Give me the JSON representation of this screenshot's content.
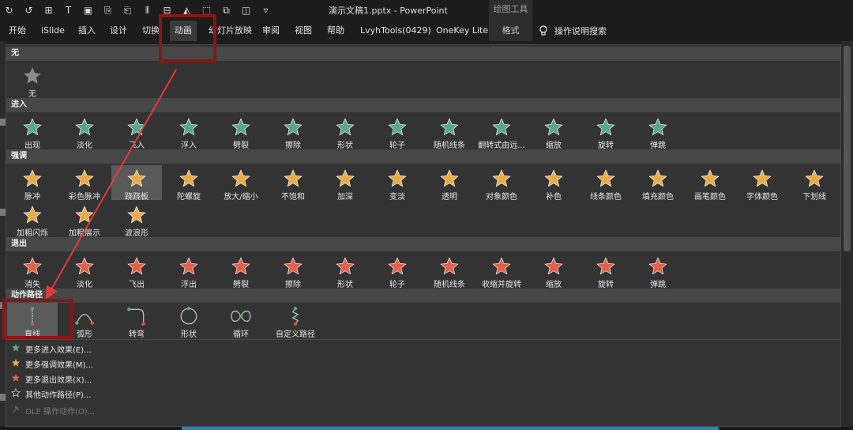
{
  "window": {
    "title": "演示文稿1.pptx  -  PowerPoint",
    "context_group": "绘图工具"
  },
  "ribbon": {
    "tabs": [
      {
        "label": "开始"
      },
      {
        "label": "iSlide"
      },
      {
        "label": "插入"
      },
      {
        "label": "设计"
      },
      {
        "label": "切换"
      },
      {
        "label": "动画",
        "active": true
      },
      {
        "label": "幻灯片放映"
      },
      {
        "label": "审阅"
      },
      {
        "label": "视图"
      },
      {
        "label": "帮助"
      },
      {
        "label": "LvyhTools(0429)"
      },
      {
        "label": "OneKey Lite"
      },
      {
        "label": "格式"
      }
    ],
    "search_label": "操作说明搜索"
  },
  "gallery": {
    "none_section": {
      "header": "无",
      "items": [
        {
          "label": "无",
          "icon": "star-gray-icon"
        }
      ]
    },
    "entrance": {
      "header": "进入",
      "color": "#5aa58e",
      "items": [
        {
          "label": "出现"
        },
        {
          "label": "淡化"
        },
        {
          "label": "飞入"
        },
        {
          "label": "浮入"
        },
        {
          "label": "劈裂"
        },
        {
          "label": "擦除"
        },
        {
          "label": "形状"
        },
        {
          "label": "轮子"
        },
        {
          "label": "随机线条"
        },
        {
          "label": "翻转式由远..."
        },
        {
          "label": "缩放"
        },
        {
          "label": "旋转"
        },
        {
          "label": "弹跳"
        }
      ]
    },
    "emphasis": {
      "header": "强调",
      "color": "#e9ab4a",
      "selected_label": "跷跷板",
      "items_row1": [
        {
          "label": "脉冲"
        },
        {
          "label": "彩色脉冲"
        },
        {
          "label": "跷跷板"
        },
        {
          "label": "陀螺旋"
        },
        {
          "label": "放大/缩小"
        },
        {
          "label": "不饱和"
        },
        {
          "label": "加深"
        },
        {
          "label": "变淡"
        },
        {
          "label": "透明"
        },
        {
          "label": "对象颜色"
        },
        {
          "label": "补色"
        },
        {
          "label": "线条颜色"
        },
        {
          "label": "填充颜色"
        },
        {
          "label": "画笔颜色"
        },
        {
          "label": "字体颜色"
        },
        {
          "label": "下划线"
        }
      ],
      "items_row2": [
        {
          "label": "加粗闪烁"
        },
        {
          "label": "加粗展示"
        },
        {
          "label": "波浪形"
        }
      ]
    },
    "exit": {
      "header": "退出",
      "color": "#e0614c",
      "items": [
        {
          "label": "消失"
        },
        {
          "label": "淡化"
        },
        {
          "label": "飞出"
        },
        {
          "label": "浮出"
        },
        {
          "label": "劈裂"
        },
        {
          "label": "擦除"
        },
        {
          "label": "形状"
        },
        {
          "label": "轮子"
        },
        {
          "label": "随机线条"
        },
        {
          "label": "收缩并旋转"
        },
        {
          "label": "缩放"
        },
        {
          "label": "旋转"
        },
        {
          "label": "弹跳"
        }
      ]
    },
    "motion_paths": {
      "header": "动作路径",
      "items": [
        {
          "label": "直线"
        },
        {
          "label": "弧形"
        },
        {
          "label": "转弯"
        },
        {
          "label": "形状"
        },
        {
          "label": "循环"
        },
        {
          "label": "自定义路径"
        }
      ]
    },
    "more_menu": [
      {
        "label": "更多进入效果(E)...",
        "icon": "star-green-icon"
      },
      {
        "label": "更多强调效果(M)...",
        "icon": "star-gold-icon"
      },
      {
        "label": "更多退出效果(X)...",
        "icon": "star-red-icon"
      },
      {
        "label": "其他动作路径(P)...",
        "icon": "star-outline-icon"
      },
      {
        "label": "OLE 操作动作(O)...",
        "icon": "ole-icon",
        "disabled": true
      }
    ]
  },
  "colors": {
    "annotation_red": "#8c1414",
    "arrow_red": "#e23a3a",
    "accent_blue": "#1e88c8"
  }
}
